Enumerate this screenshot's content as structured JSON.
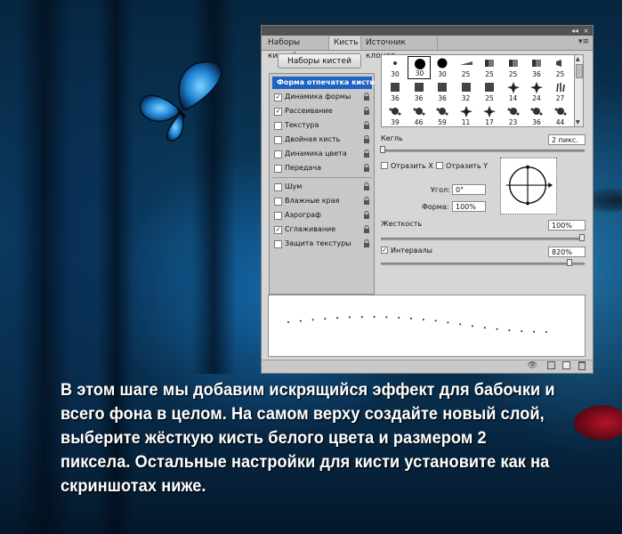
{
  "panel": {
    "tabs": [
      "Наборы кистей",
      "Кисть",
      "Источник клонов"
    ],
    "active_tab": "Кисть",
    "title_controls": [
      "◂◂",
      "×"
    ],
    "menu_icon": "panel-menu-icon",
    "presets_button": "Наборы кистей"
  },
  "brush_settings": {
    "selected_item": "Форма отпечатка кисти",
    "items": [
      {
        "label": "Динамика формы",
        "checked": true
      },
      {
        "label": "Рассеивание",
        "checked": true
      },
      {
        "label": "Текстура",
        "checked": false
      },
      {
        "label": "Двойная кисть",
        "checked": false
      },
      {
        "label": "Динамика цвета",
        "checked": false
      },
      {
        "label": "Передача",
        "checked": false
      },
      {
        "label": "Шум",
        "checked": false
      },
      {
        "label": "Влажные края",
        "checked": false
      },
      {
        "label": "Аэрограф",
        "checked": false
      },
      {
        "label": "Сглаживание",
        "checked": true
      },
      {
        "label": "Защита текстуры",
        "checked": false
      }
    ]
  },
  "brush_grid": {
    "rows": [
      [
        "30",
        "30",
        "30",
        "25",
        "25",
        "25",
        "36",
        "25"
      ],
      [
        "36",
        "36",
        "36",
        "32",
        "25",
        "14",
        "24",
        "27"
      ],
      [
        "39",
        "46",
        "59",
        "11",
        "17",
        "23",
        "36",
        "44"
      ]
    ],
    "selected_index": 1
  },
  "controls": {
    "size_label": "Кегль",
    "size_value": "2 пикс.",
    "flip_x_label": "Отразить X",
    "flip_y_label": "Отразить Y",
    "flip_x": false,
    "flip_y": false,
    "angle_label": "Угол:",
    "angle_value": "0°",
    "roundness_label": "Форма:",
    "roundness_value": "100%",
    "hardness_label": "Жесткость",
    "hardness_value": "100%",
    "hardness_fraction": 1.0,
    "spacing_label": "Интервалы",
    "spacing_value": "820%",
    "spacing_checked": true
  },
  "caption": "В этом шаге мы добавим искрящийся эффект для бабочки и всего фона в целом. На самом верху создайте новый слой, выберите жёсткую кисть  белого цвета и размером 2 пиксела. Остальные настройки для кисти установите как на скриншотах ниже."
}
